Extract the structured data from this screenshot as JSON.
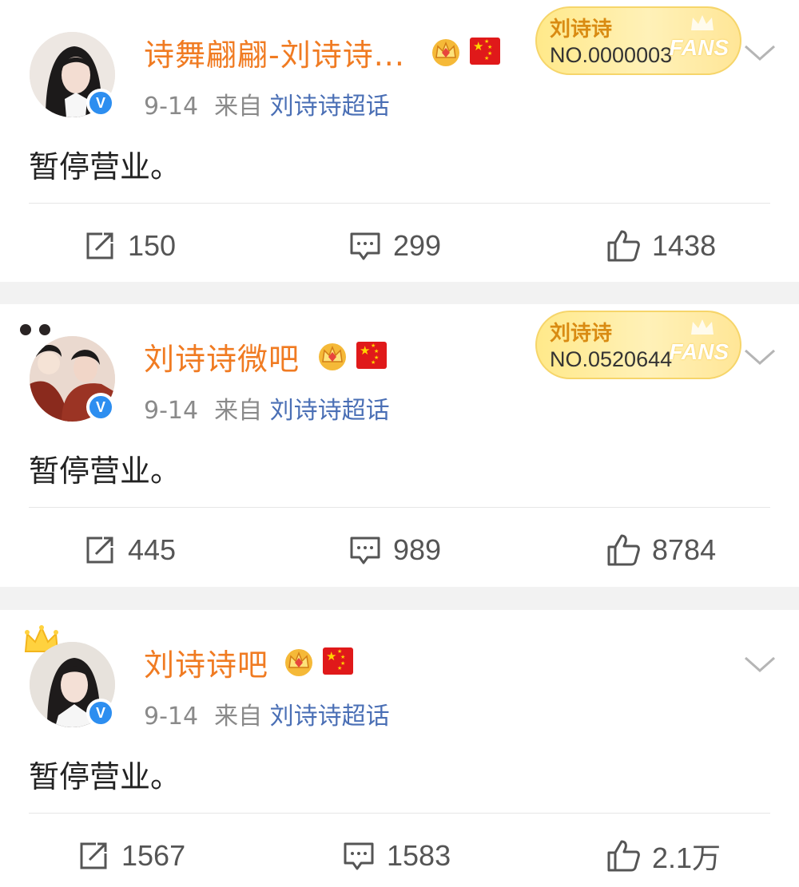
{
  "posts": [
    {
      "username": "诗舞翩翩-刘诗诗...",
      "date": "9-14",
      "source_prefix": "来自",
      "source": "刘诗诗超话",
      "content": "暂停营业。",
      "verified_mark": "V",
      "fans_badge": {
        "name": "刘诗诗",
        "number": "NO.0000003",
        "label": "FANS"
      },
      "stats": {
        "reposts": "150",
        "comments": "299",
        "likes": "1438"
      }
    },
    {
      "username": "刘诗诗微吧",
      "date": "9-14",
      "source_prefix": "来自",
      "source": "刘诗诗超话",
      "content": "暂停营业。",
      "verified_mark": "V",
      "fans_badge": {
        "name": "刘诗诗",
        "number": "NO.0520644",
        "label": "FANS"
      },
      "stats": {
        "reposts": "445",
        "comments": "989",
        "likes": "8784"
      }
    },
    {
      "username": "刘诗诗吧",
      "date": "9-14",
      "source_prefix": "来自",
      "source": "刘诗诗超话",
      "content": "暂停营业。",
      "verified_mark": "V",
      "stats": {
        "reposts": "1567",
        "comments": "1583",
        "likes": "2.1万"
      }
    }
  ],
  "colors": {
    "username": "#f07b22",
    "source_link": "#4a6fb5",
    "meta": "#8a8a8a",
    "verified": "#2d8ef0",
    "separator_bg": "#f2f2f2"
  },
  "icons": [
    "crown-icon",
    "china-flag-icon",
    "verified-icon",
    "chevron-down-icon",
    "repost-icon",
    "comment-icon",
    "like-icon"
  ]
}
